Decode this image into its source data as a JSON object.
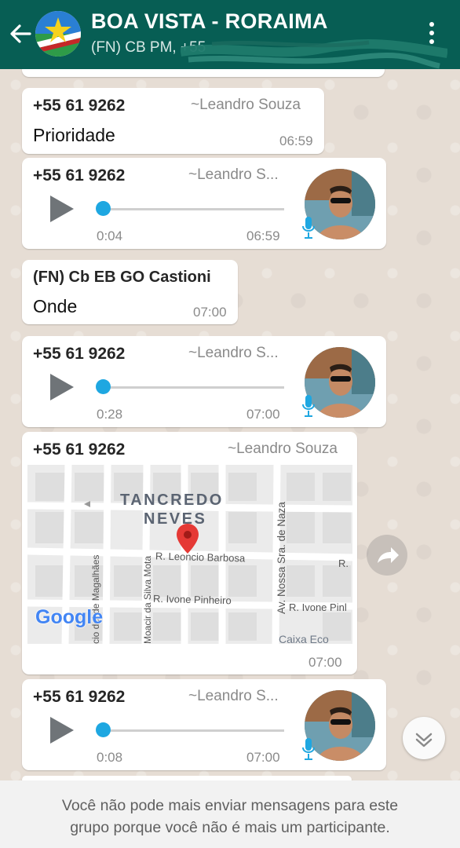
{
  "header": {
    "title": "BOA VISTA - RORAIMA",
    "subtitle": "(FN) CB PM, +55 "
  },
  "messages": [
    {
      "type": "text",
      "sender": "+55 61 9262",
      "alias": "~Leandro Souza",
      "text": "Prioridade",
      "time": "06:59"
    },
    {
      "type": "voice",
      "sender": "+55 61 9262",
      "alias": "~Leandro S...",
      "duration": "0:04",
      "time": "06:59",
      "progress": 0
    },
    {
      "type": "text",
      "sender": "(FN) Cb EB GO Castioni",
      "text": "Onde",
      "time": "07:00"
    },
    {
      "type": "voice",
      "sender": "+55 61 9262",
      "alias": "~Leandro S...",
      "duration": "0:28",
      "time": "07:00",
      "progress": 0
    },
    {
      "type": "location",
      "sender": "+55 61 9262",
      "alias": "~Leandro Souza",
      "time": "07:00"
    },
    {
      "type": "voice",
      "sender": "+55 61 9262",
      "alias": "~Leandro S...",
      "duration": "0:08",
      "time": "07:00",
      "progress": 0
    }
  ],
  "map": {
    "neighborhood_line1": "TANCREDO",
    "neighborhood_line2": "NEVES",
    "streets": {
      "barbosa": "R. Leoncio Barbosa",
      "barbosa_cut": "R.",
      "pinheiro": "R. Ivone Pinheiro",
      "pinheiro_right": "R. Ivone Pinl",
      "av_nossa": "Av. Nossa Sra. de Naza",
      "moacir": "Moacir da Silva Mota",
      "magalhaes": "cio del de Magalhães",
      "caixa": "Caixa Eco"
    },
    "logo": "Google",
    "colors": {
      "pin": "#e53935",
      "roads": "#ffffff",
      "blocks": "#e4e4e4"
    }
  },
  "footer": {
    "line1": "Você não pode mais enviar mensagens para este",
    "line2": "grupo porque você não é mais um participante."
  },
  "icons": [
    "back-arrow-icon",
    "group-flag-icon",
    "more-vert-icon",
    "play-icon",
    "mic-icon",
    "location-pin-icon",
    "forward-icon",
    "chevron-double-down-icon"
  ],
  "colors": {
    "header": "#075e54",
    "accent": "#1ea7e1",
    "bubble": "#ffffff",
    "chat_bg": "#e6ddd4"
  }
}
